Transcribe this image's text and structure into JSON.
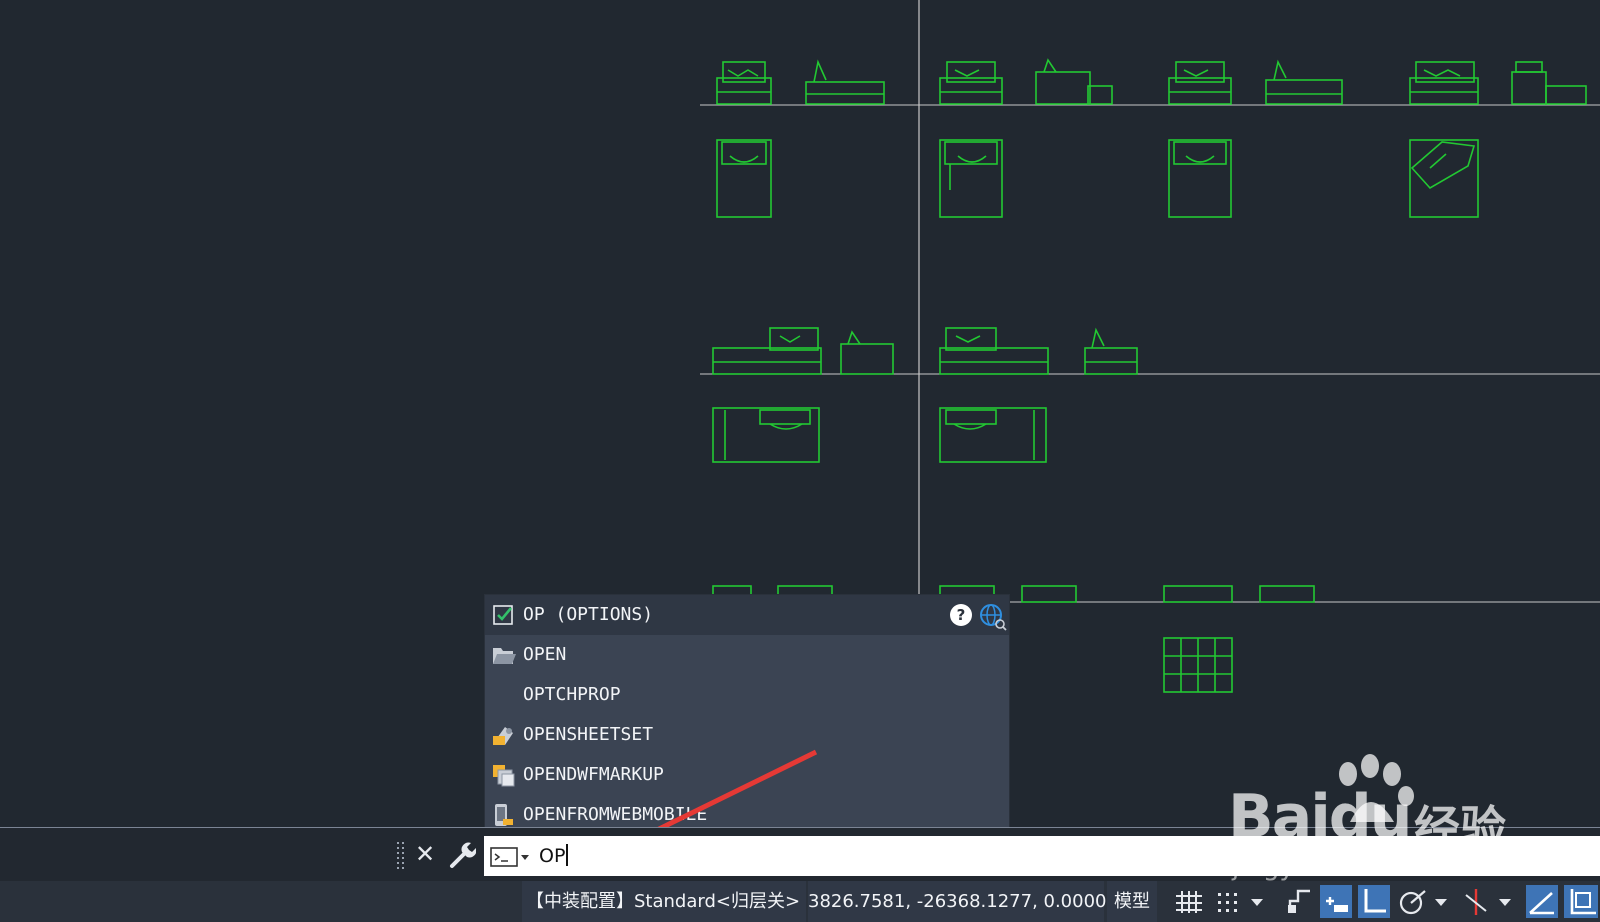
{
  "autocomplete": {
    "items": [
      {
        "label": "OP (OPTIONS)",
        "icon": "checkbox-checked-icon",
        "selected": true
      },
      {
        "label": "OPEN",
        "icon": "folder-open-icon"
      },
      {
        "label": "OPTCHPROP",
        "icon": ""
      },
      {
        "label": "OPENSHEETSET",
        "icon": "sheetset-icon"
      },
      {
        "label": "OPENDWFMARKUP",
        "icon": "markup-icon"
      },
      {
        "label": "OPENFROMWEBMOBILE",
        "icon": "mobile-icon"
      }
    ],
    "help_icon": "help-icon",
    "web_search_icon": "globe-search-icon"
  },
  "command_line": {
    "input_value": "OP",
    "close_label": "✕"
  },
  "status_bar": {
    "config": "【中装配置】Standard<归层关>",
    "coordinates": "3826.7581, -26368.1277, 0.0000",
    "model_tab": "模型"
  },
  "watermark": {
    "logo_text": "Bai",
    "logo_text2": "du",
    "cn_text": "经验",
    "url": "jingyan.baidu.com"
  },
  "colors": {
    "background": "#212830",
    "drawing_lines": "#22c832",
    "dropdown_bg": "#3b4453",
    "toggle_on": "#3e74b6",
    "arrow": "#e53935"
  }
}
